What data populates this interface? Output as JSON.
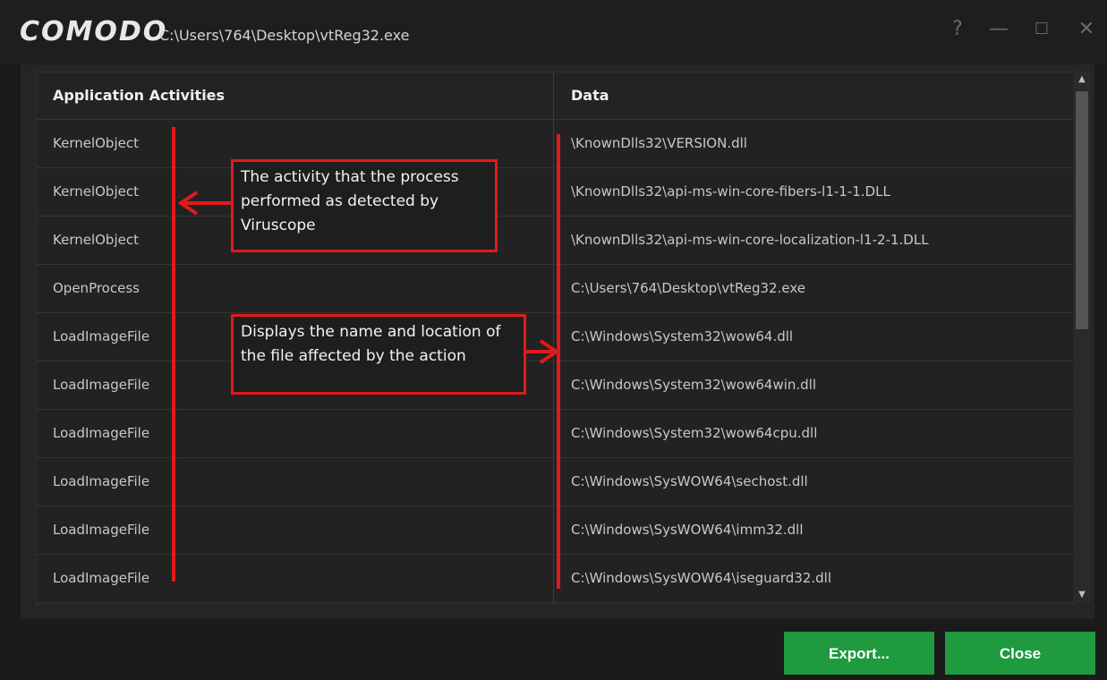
{
  "window": {
    "logo": "COMODO",
    "path": "C:\\Users\\764\\Desktop\\vtReg32.exe",
    "help": "?",
    "minimize": "—",
    "maximize": "☐",
    "close": "✕"
  },
  "table": {
    "columns": [
      "Application Activities",
      "Data"
    ],
    "rows": [
      {
        "activity": "KernelObject",
        "data": "\\KnownDlls32\\VERSION.dll"
      },
      {
        "activity": "KernelObject",
        "data": "\\KnownDlls32\\api-ms-win-core-fibers-l1-1-1.DLL"
      },
      {
        "activity": "KernelObject",
        "data": "\\KnownDlls32\\api-ms-win-core-localization-l1-2-1.DLL"
      },
      {
        "activity": "OpenProcess",
        "data": "C:\\Users\\764\\Desktop\\vtReg32.exe"
      },
      {
        "activity": "LoadImageFile",
        "data": "C:\\Windows\\System32\\wow64.dll"
      },
      {
        "activity": "LoadImageFile",
        "data": "C:\\Windows\\System32\\wow64win.dll"
      },
      {
        "activity": "LoadImageFile",
        "data": "C:\\Windows\\System32\\wow64cpu.dll"
      },
      {
        "activity": "LoadImageFile",
        "data": "C:\\Windows\\SysWOW64\\sechost.dll"
      },
      {
        "activity": "LoadImageFile",
        "data": "C:\\Windows\\SysWOW64\\imm32.dll"
      },
      {
        "activity": "LoadImageFile",
        "data": "C:\\Windows\\SysWOW64\\iseguard32.dll"
      }
    ]
  },
  "annotations": {
    "activity_note": "The activity that the process performed as detected by Viruscope",
    "data_note": "Displays the name and location of the file affected by the action"
  },
  "buttons": {
    "export": "Export...",
    "close": "Close"
  },
  "colors": {
    "accent_green": "#1f9a3e",
    "annotation_red": "#e11a1a",
    "background": "#1b1b1b"
  }
}
